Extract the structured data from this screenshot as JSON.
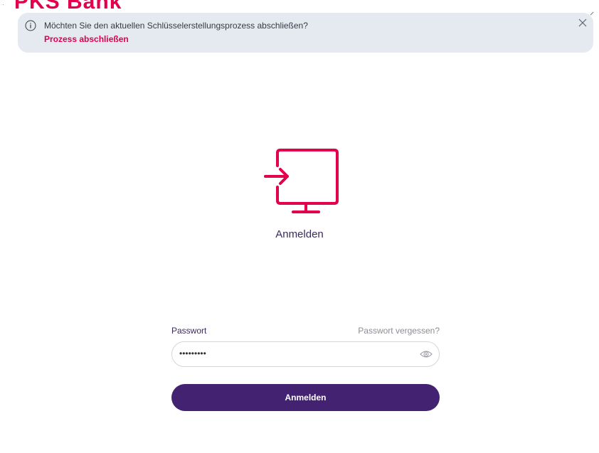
{
  "brand": {
    "name": "PKS Bank"
  },
  "banner": {
    "message": "Möchten Sie den aktuellen Schlüsselerstellungsprozess abschließen?",
    "action_label": "Prozess abschließen",
    "icon": "info-icon",
    "close_icon": "close-icon"
  },
  "hero": {
    "icon": "monitor-login-icon",
    "title": "Anmelden"
  },
  "form": {
    "password_label": "Passwort",
    "forgot_label": "Passwort vergessen?",
    "password_value": "•••••••••",
    "toggle_icon": "eye-icon",
    "submit_label": "Anmelden"
  },
  "colors": {
    "brand": "#e2004e",
    "primary": "#432371",
    "banner_bg": "#e4eaef",
    "text": "#3b2a5b",
    "muted": "#8d8d95"
  }
}
